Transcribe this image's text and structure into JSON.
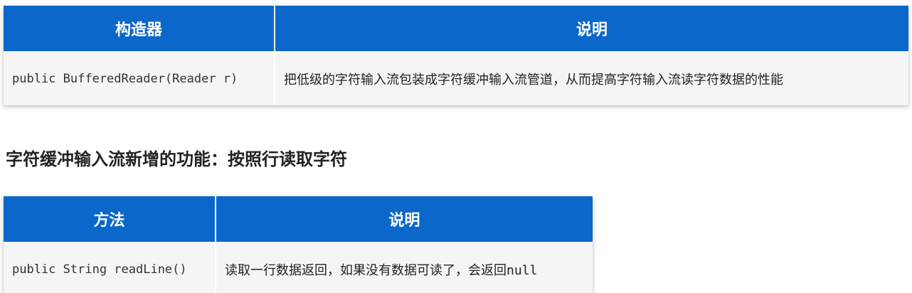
{
  "table1": {
    "headers": [
      "构造器",
      "说明"
    ],
    "rows": [
      {
        "code": "public BufferedReader(Reader r)",
        "desc": "把低级的字符输入流包装成字符缓冲输入流管道，从而提高字符输入流读字符数据的性能"
      }
    ]
  },
  "section_heading": "字符缓冲输入流新增的功能：按照行读取字符",
  "table2": {
    "headers": [
      "方法",
      "说明"
    ],
    "rows": [
      {
        "code": "public String readLine()",
        "desc_text": "读取一行数据返回，如果没有数据可读了，会返回",
        "desc_code": "null"
      }
    ]
  },
  "colors": {
    "header_bg": "#0b67c9",
    "header_text": "#ffffff",
    "row_bg": "#f5f5f5"
  }
}
